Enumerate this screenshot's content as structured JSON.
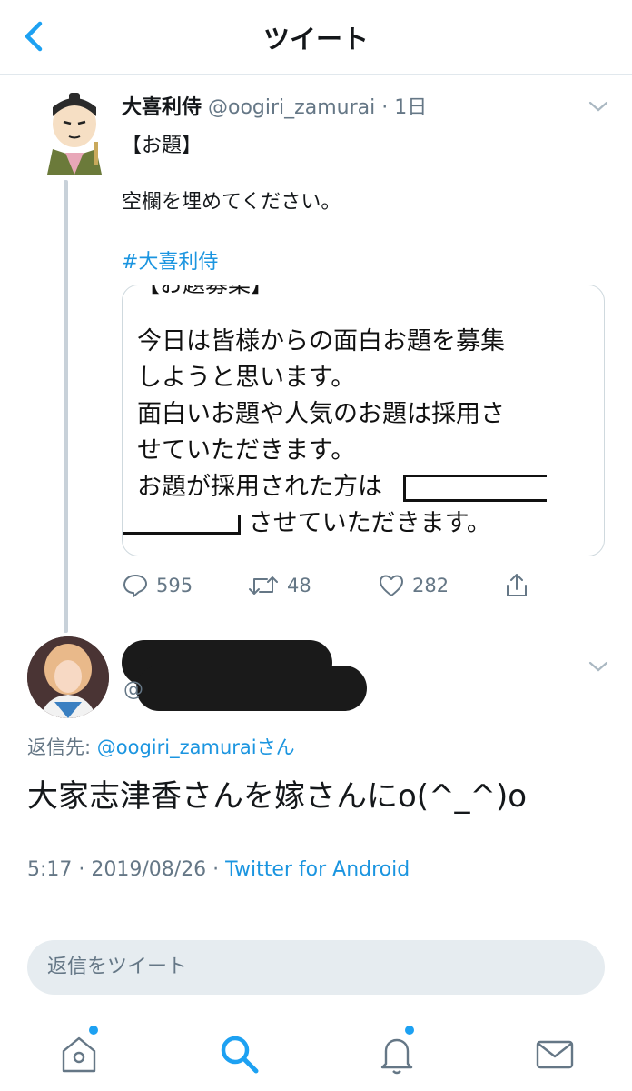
{
  "header": {
    "title": "ツイート"
  },
  "quoted_tweet": {
    "name": "大喜利侍",
    "handle": "@oogiri_zamurai",
    "time": "1日",
    "line1": "【お題】",
    "line2": "空欄を埋めてください。",
    "hashtag": "#大喜利侍",
    "image_text": {
      "heading": "【お題募集】",
      "line1": "今日は皆様からの面白お題を募集",
      "line2": "しようと思います。",
      "line3": "面白いお題や人気のお題は採用さ",
      "line4": "せていただきます。",
      "line5": "お題が採用された方は",
      "line6": "させていただきます。"
    },
    "stats": {
      "replies": "595",
      "retweets": "48",
      "likes": "282"
    }
  },
  "reply_tweet": {
    "handle_prefix": "@",
    "reply_to_label": "返信先: ",
    "reply_to_handle": "@oogiri_zamuraiさん",
    "text": "大家志津香さんを嫁さんにo(^_^)o",
    "time": "5:17 · 2019/08/26 · ",
    "source": "Twitter for Android"
  },
  "reply_box": {
    "placeholder": "返信をツイート"
  },
  "tabbar": {
    "accent": "#1da1f2",
    "icons": [
      "home-icon",
      "search-icon",
      "notifications-icon",
      "messages-icon"
    ]
  },
  "colors": {
    "link": "#1b95e0",
    "secondary": "#657786",
    "accent": "#1da1f2"
  }
}
